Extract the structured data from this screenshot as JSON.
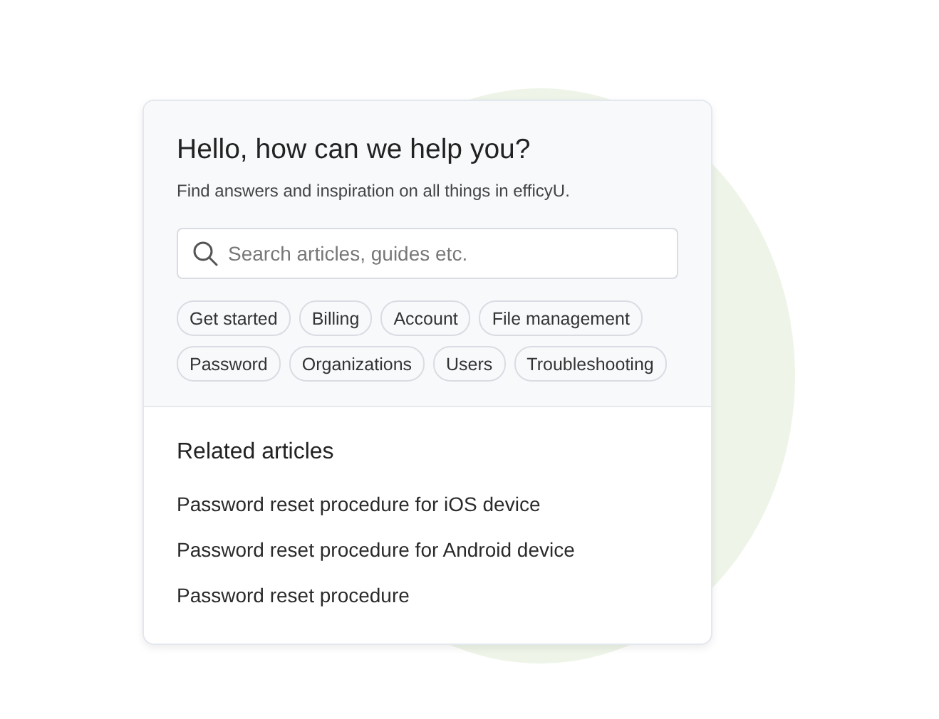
{
  "help": {
    "title": "Hello, how can we help you?",
    "subtitle": "Find answers and inspiration on all things in efficyU.",
    "search": {
      "placeholder": "Search articles, guides etc."
    },
    "topics": [
      "Get started",
      "Billing",
      "Account",
      "File management",
      "Password",
      "Organizations",
      "Users",
      "Troubleshooting"
    ]
  },
  "related": {
    "title": "Related articles",
    "articles": [
      "Password reset procedure for iOS device",
      "Password reset procedure for Android device",
      "Password reset procedure"
    ]
  }
}
